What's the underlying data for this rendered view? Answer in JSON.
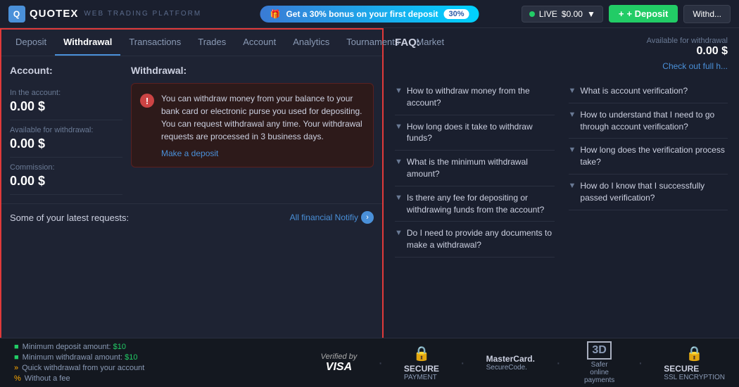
{
  "header": {
    "logo_text": "QUOTEX",
    "subtitle": "WEB TRADING PLATFORM",
    "bonus_text": "Get a 30% bonus on your first deposit",
    "bonus_pct": "30%",
    "live_label": "LIVE",
    "balance": "$0.00",
    "deposit_label": "+ Deposit",
    "withdraw_label": "Withd..."
  },
  "tabs": {
    "items": [
      {
        "label": "Deposit",
        "active": false
      },
      {
        "label": "Withdrawal",
        "active": true
      },
      {
        "label": "Transactions",
        "active": false
      },
      {
        "label": "Trades",
        "active": false
      },
      {
        "label": "Account",
        "active": false
      },
      {
        "label": "Analytics",
        "active": false
      },
      {
        "label": "Tournaments",
        "active": false
      },
      {
        "label": "Market",
        "active": false
      }
    ]
  },
  "account": {
    "title": "Account:",
    "in_account_label": "In the account:",
    "in_account_value": "0.00 $",
    "available_label": "Available for withdrawal:",
    "available_value": "0.00 $",
    "commission_label": "Commission:",
    "commission_value": "0.00 $"
  },
  "withdrawal": {
    "title": "Withdrawal:",
    "info_text": "You can withdraw money from your balance to your bank card or electronic purse you used for depositing. You can request withdrawal any time. Your withdrawal requests are processed in 3 business days.",
    "make_deposit_label": "Make a deposit"
  },
  "latest_requests": {
    "title": "Some of your latest requests:",
    "all_notif_label": "All financial Notifiy"
  },
  "right_panel": {
    "available_label": "Available for withdrawal",
    "available_value": "0.00 $",
    "check_full_label": "Check out full h...",
    "faq_title": "FAQ:",
    "faq_left": [
      {
        "text": "How to withdraw money from the account?"
      },
      {
        "text": "How long does it take to withdraw funds?"
      },
      {
        "text": "What is the minimum withdrawal amount?"
      },
      {
        "text": "Is there any fee for depositing or withdrawing funds from the account?"
      },
      {
        "text": "Do I need to provide any documents to make a withdrawal?"
      }
    ],
    "faq_right": [
      {
        "text": "What is account verification?"
      },
      {
        "text": "How to understand that I need to go through account verification?"
      },
      {
        "text": "How long does the verification process take?"
      },
      {
        "text": "How do I know that I successfully passed verification?"
      }
    ]
  },
  "footer": {
    "items": [
      {
        "icon": "■",
        "color": "green",
        "text": "Minimum deposit amount: $10"
      },
      {
        "icon": "■",
        "color": "green",
        "text": "Minimum withdrawal amount: $10"
      },
      {
        "icon": "»",
        "color": "orange",
        "text": "Quick withdrawal from your account"
      },
      {
        "icon": "%",
        "color": "orange",
        "text": "Without a fee"
      }
    ],
    "badges": [
      {
        "name": "verified-visa",
        "line1": "Verified by",
        "line2": "VISA"
      },
      {
        "name": "secure-payment",
        "icon": "🔒",
        "line1": "SECURE",
        "line2": "PAYMENT"
      },
      {
        "name": "mastercard",
        "line1": "MasterCard.",
        "line2": "SecureCode."
      },
      {
        "name": "3d-secure",
        "line1": "3D",
        "line2": "Safer online payments"
      },
      {
        "name": "ssl",
        "icon": "🔒",
        "line1": "SECURE",
        "line2": "SSL ENCRYPTION"
      }
    ]
  }
}
